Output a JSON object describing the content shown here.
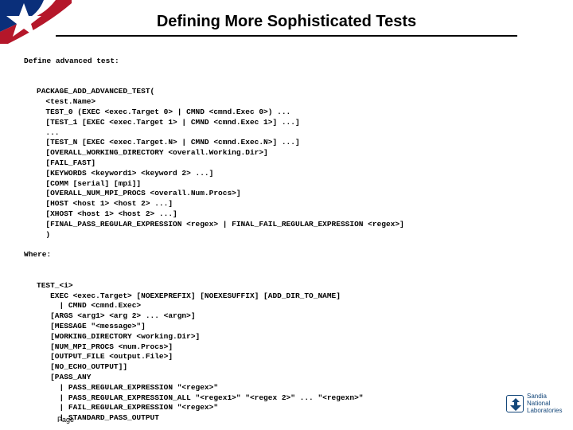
{
  "title": "Defining More Sophisticated Tests",
  "intro": "Define advanced test:",
  "block1": {
    "l1": "PACKAGE_ADD_ADVANCED_TEST(",
    "l2": "  <test.Name>",
    "l3": "  TEST_0 (EXEC <exec.Target 0> | CMND <cmnd.Exec 0>) ...",
    "l4": "  [TEST_1 [EXEC <exec.Target 1> | CMND <cmnd.Exec 1>] ...]",
    "l5": "  ...",
    "l6": "  [TEST_N [EXEC <exec.Target.N> | CMND <cmnd.Exec.N>] ...]",
    "l7": "  [OVERALL_WORKING_DIRECTORY <overall.Working.Dir>]",
    "l8": "  [FAIL_FAST]",
    "l9": "  [KEYWORDS <keyword1> <keyword 2> ...]",
    "l10": "  [COMM [serial] [mpi]]",
    "l11": "  [OVERALL_NUM_MPI_PROCS <overall.Num.Procs>]",
    "l12": "  [HOST <host 1> <host 2> ...]",
    "l13": "  [XHOST <host 1> <host 2> ...]",
    "l14": "  [FINAL_PASS_REGULAR_EXPRESSION <regex> | FINAL_FAIL_REGULAR_EXPRESSION <regex>]",
    "l15": "  )"
  },
  "where": "Where:",
  "block2": {
    "l1": "TEST_<i>",
    "l2": "   EXEC <exec.Target> [NOEXEPREFIX] [NOEXESUFFIX] [ADD_DIR_TO_NAME]",
    "l3": "     | CMND <cmnd.Exec>",
    "l4": "   [ARGS <arg1> <arg 2> ... <argn>]",
    "l5": "   [MESSAGE \"<message>\"]",
    "l6": "   [WORKING_DIRECTORY <working.Dir>]",
    "l7": "   [NUM_MPI_PROCS <num.Procs>]",
    "l8": "   [OUTPUT_FILE <output.File>]",
    "l9": "   [NO_ECHO_OUTPUT]]",
    "l10": "   [PASS_ANY",
    "l11": "     | PASS_REGULAR_EXPRESSION \"<regex>\"",
    "l12": "     | PASS_REGULAR_EXPRESSION_ALL \"<regex1>\" \"<regex 2>\" ... \"<regexn>\"",
    "l13": "     | FAIL_REGULAR_EXPRESSION \"<regex>\"",
    "l14": "     | STANDARD_PASS_OUTPUT"
  },
  "page_label": "Page",
  "footer": {
    "line1": "Sandia",
    "line2": "National",
    "line3": "Laboratories"
  }
}
